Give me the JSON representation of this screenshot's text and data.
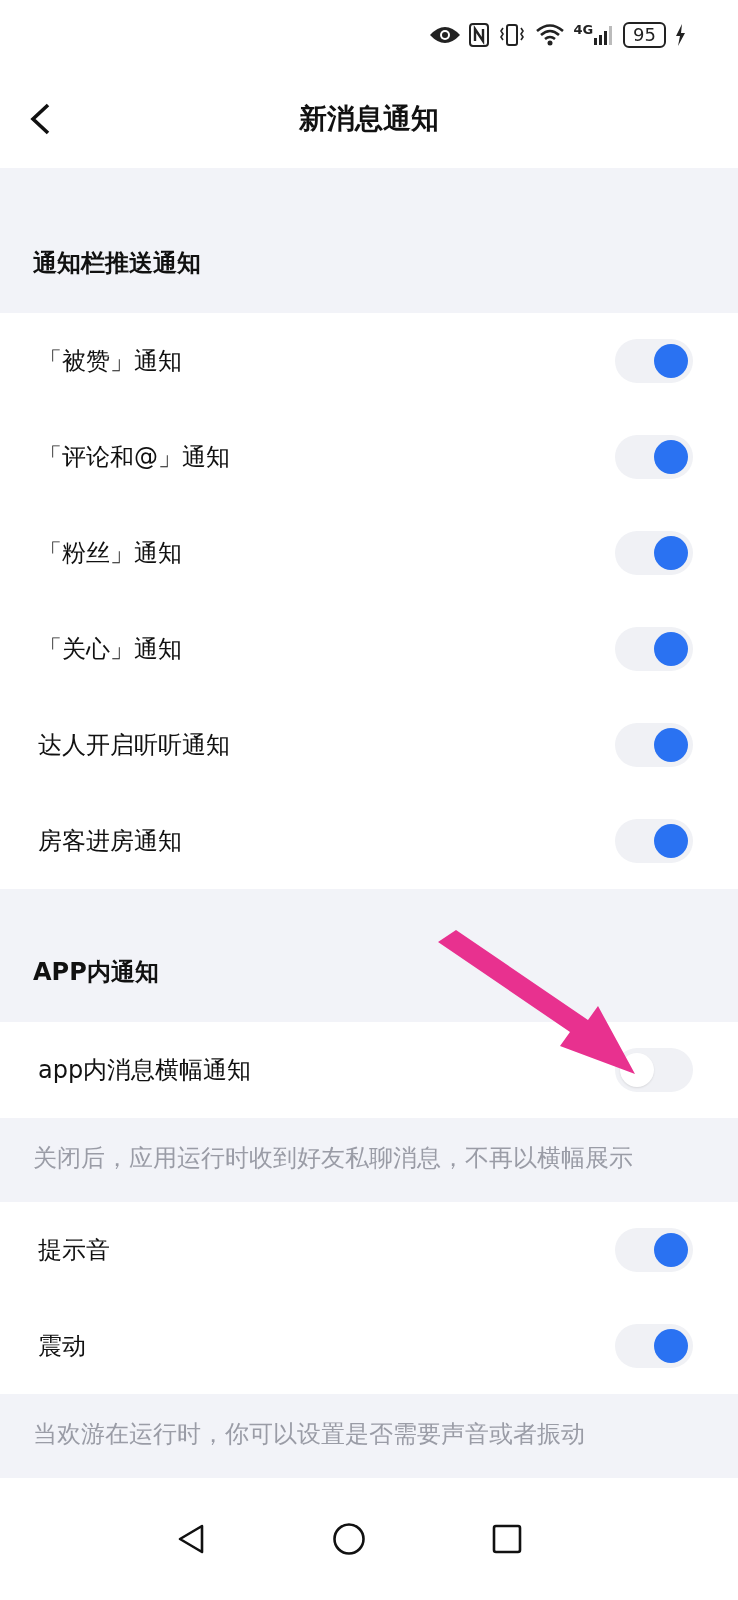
{
  "status_bar": {
    "battery": "95",
    "network": "4G"
  },
  "header": {
    "title": "新消息通知"
  },
  "groups": [
    {
      "title": "通知栏推送通知",
      "rows": [
        {
          "label": "「被赞」通知",
          "on": true
        },
        {
          "label": "「评论和@」通知",
          "on": true
        },
        {
          "label": "「粉丝」通知",
          "on": true
        },
        {
          "label": "「关心」通知",
          "on": true
        },
        {
          "label": "达人开启听听通知",
          "on": true
        },
        {
          "label": "房客进房通知",
          "on": true
        }
      ]
    },
    {
      "title": "APP内通知",
      "rows": [
        {
          "label": "app内消息横幅通知",
          "on": false
        }
      ],
      "note": "关闭后，应用运行时收到好友私聊消息，不再以横幅展示"
    },
    {
      "rows": [
        {
          "label": "提示音",
          "on": true
        },
        {
          "label": "震动",
          "on": true
        }
      ],
      "note": "当欢游在运行时，你可以设置是否需要声音或者振动"
    }
  ]
}
